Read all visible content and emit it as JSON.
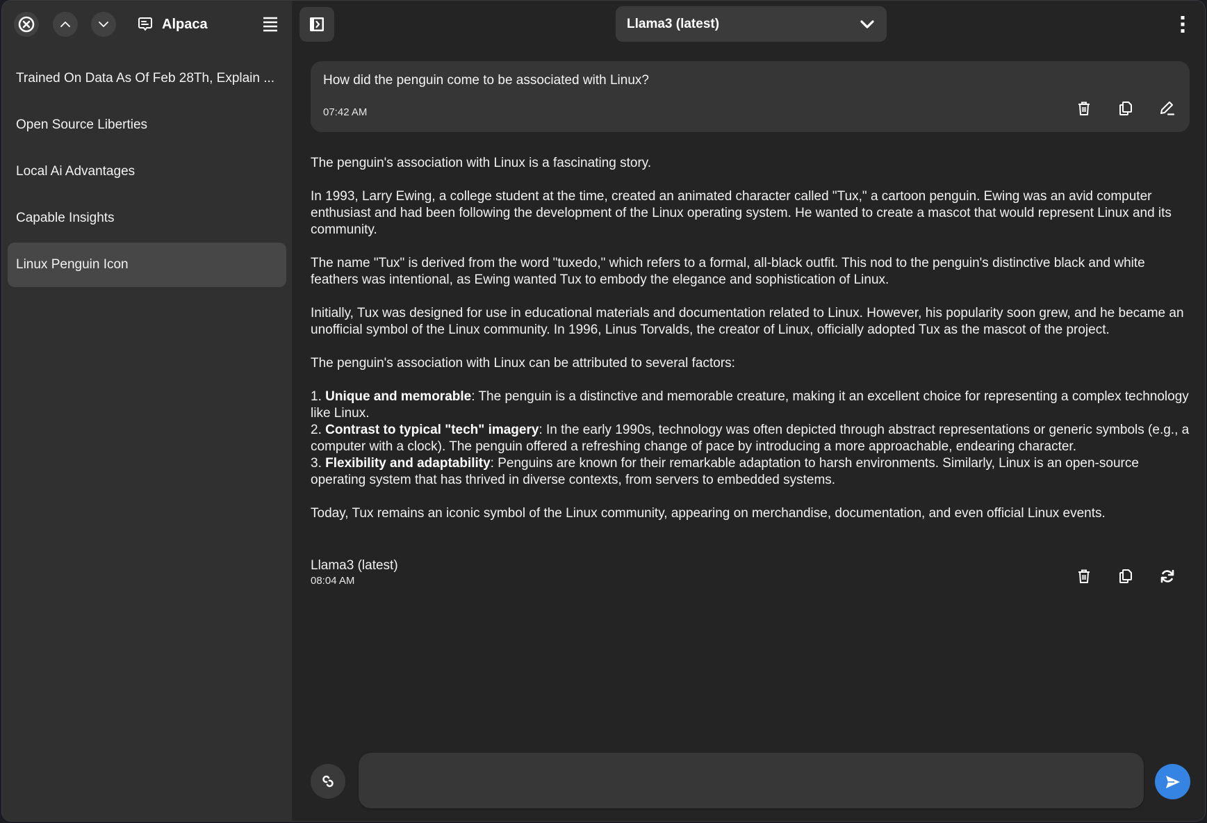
{
  "app": {
    "title": "Alpaca"
  },
  "sidebar": {
    "items": [
      {
        "label": "Trained On Data As Of Feb 28Th, Explain ..."
      },
      {
        "label": "Open Source Liberties"
      },
      {
        "label": "Local Ai Advantages"
      },
      {
        "label": "Capable Insights"
      },
      {
        "label": "Linux Penguin Icon",
        "active": true
      }
    ]
  },
  "header": {
    "model_selected": "Llama3 (latest)"
  },
  "conversation": {
    "user_message": {
      "text": "How did the penguin come to be associated with Linux?",
      "time": "07:42 AM"
    },
    "bot_message": {
      "paragraphs": [
        "The penguin's association with Linux is a fascinating story.",
        "In 1993, Larry Ewing, a college student at the time, created an animated character called \"Tux,\" a cartoon penguin. Ewing was an avid computer enthusiast and had been following the development of the Linux operating system. He wanted to create a mascot that would represent Linux and its community.",
        "The name \"Tux\" is derived from the word \"tuxedo,\" which refers to a formal, all-black outfit. This nod to the penguin's distinctive black and white feathers was intentional, as Ewing wanted Tux to embody the elegance and sophistication of Linux.",
        "Initially, Tux was designed for use in educational materials and documentation related to Linux. However, his popularity soon grew, and he became an unofficial symbol of the Linux community. In 1996, Linus Torvalds, the creator of Linux, officially adopted Tux as the mascot of the project.",
        "The penguin's association with Linux can be attributed to several factors:"
      ],
      "list": [
        {
          "num": "1. ",
          "bold": "Unique and memorable",
          "rest": ": The penguin is a distinctive and memorable creature, making it an excellent choice for representing a complex technology like Linux."
        },
        {
          "num": "2. ",
          "bold": "Contrast to typical \"tech\" imagery",
          "rest": ": In the early 1990s, technology was often depicted through abstract representations or generic symbols (e.g., a computer with a clock). The penguin offered a refreshing change of pace by introducing a more approachable, endearing character."
        },
        {
          "num": "3. ",
          "bold": "Flexibility and adaptability",
          "rest": ": Penguins are known for their remarkable adaptation to harsh environments. Similarly, Linux is an open-source operating system that has thrived in diverse contexts, from servers to embedded systems."
        }
      ],
      "closing": "Today, Tux remains an iconic symbol of the Linux community, appearing on merchandise, documentation, and even official Linux events.",
      "model": "Llama3 (latest)",
      "time": "08:04 AM"
    }
  },
  "composer": {
    "value": "",
    "placeholder": ""
  },
  "icons": {
    "close": "close-circle-icon",
    "up": "chevron-up-icon",
    "down": "chevron-down-icon",
    "new_chat": "chat-bubble-icon",
    "menu": "hamburger-icon",
    "sidebar_toggle": "sidebar-toggle-icon",
    "dropdown": "chevron-down-icon",
    "more": "kebab-menu-icon",
    "delete": "trash-icon",
    "copy": "copy-icon",
    "edit": "pencil-icon",
    "regenerate": "refresh-icon",
    "attach": "link-icon",
    "send": "send-icon"
  },
  "colors": {
    "accent": "#3584e4",
    "sidebar_bg": "#303030",
    "main_bg": "#242424",
    "active_item": "#474747"
  }
}
